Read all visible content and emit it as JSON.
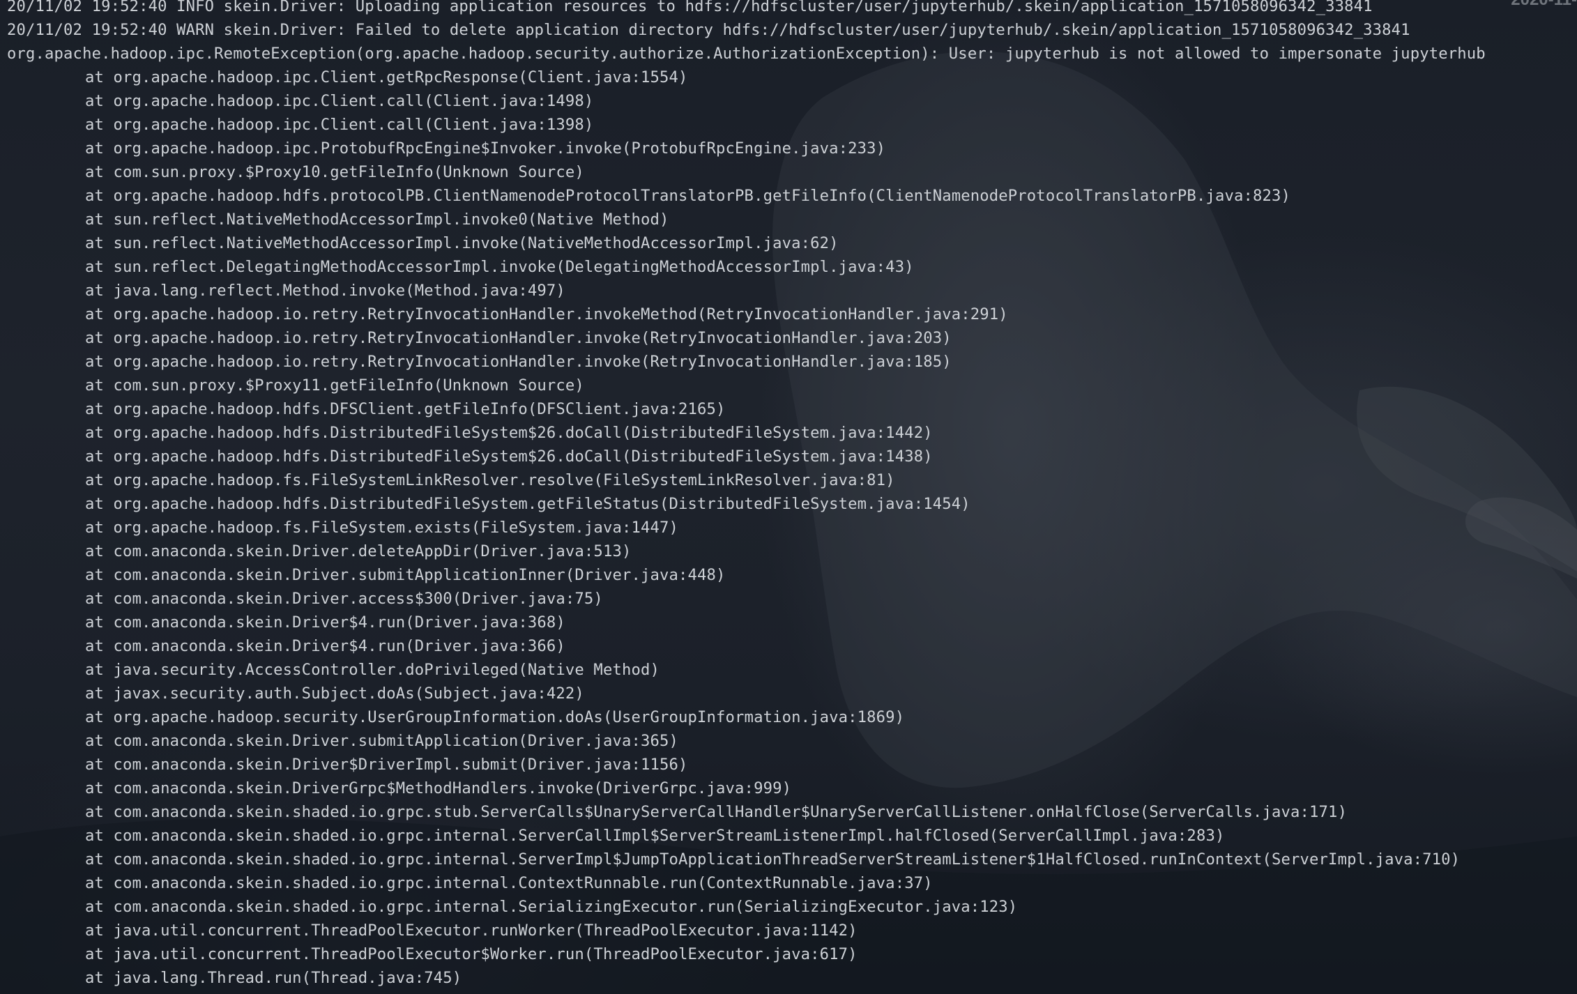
{
  "window": {
    "clock_fragment": "2020-11-"
  },
  "log": {
    "header_lines": [
      "20/11/02 19:52:40 INFO skein.Driver: Uploading application resources to hdfs://hdfscluster/user/jupyterhub/.skein/application_1571058096342_33841",
      "20/11/02 19:52:40 WARN skein.Driver: Failed to delete application directory hdfs://hdfscluster/user/jupyterhub/.skein/application_1571058096342_33841",
      "org.apache.hadoop.ipc.RemoteException(org.apache.hadoop.security.authorize.AuthorizationException): User: jupyterhub is not allowed to impersonate jupyterhub"
    ],
    "stack_frames": [
      "at org.apache.hadoop.ipc.Client.getRpcResponse(Client.java:1554)",
      "at org.apache.hadoop.ipc.Client.call(Client.java:1498)",
      "at org.apache.hadoop.ipc.Client.call(Client.java:1398)",
      "at org.apache.hadoop.ipc.ProtobufRpcEngine$Invoker.invoke(ProtobufRpcEngine.java:233)",
      "at com.sun.proxy.$Proxy10.getFileInfo(Unknown Source)",
      "at org.apache.hadoop.hdfs.protocolPB.ClientNamenodeProtocolTranslatorPB.getFileInfo(ClientNamenodeProtocolTranslatorPB.java:823)",
      "at sun.reflect.NativeMethodAccessorImpl.invoke0(Native Method)",
      "at sun.reflect.NativeMethodAccessorImpl.invoke(NativeMethodAccessorImpl.java:62)",
      "at sun.reflect.DelegatingMethodAccessorImpl.invoke(DelegatingMethodAccessorImpl.java:43)",
      "at java.lang.reflect.Method.invoke(Method.java:497)",
      "at org.apache.hadoop.io.retry.RetryInvocationHandler.invokeMethod(RetryInvocationHandler.java:291)",
      "at org.apache.hadoop.io.retry.RetryInvocationHandler.invoke(RetryInvocationHandler.java:203)",
      "at org.apache.hadoop.io.retry.RetryInvocationHandler.invoke(RetryInvocationHandler.java:185)",
      "at com.sun.proxy.$Proxy11.getFileInfo(Unknown Source)",
      "at org.apache.hadoop.hdfs.DFSClient.getFileInfo(DFSClient.java:2165)",
      "at org.apache.hadoop.hdfs.DistributedFileSystem$26.doCall(DistributedFileSystem.java:1442)",
      "at org.apache.hadoop.hdfs.DistributedFileSystem$26.doCall(DistributedFileSystem.java:1438)",
      "at org.apache.hadoop.fs.FileSystemLinkResolver.resolve(FileSystemLinkResolver.java:81)",
      "at org.apache.hadoop.hdfs.DistributedFileSystem.getFileStatus(DistributedFileSystem.java:1454)",
      "at org.apache.hadoop.fs.FileSystem.exists(FileSystem.java:1447)",
      "at com.anaconda.skein.Driver.deleteAppDir(Driver.java:513)",
      "at com.anaconda.skein.Driver.submitApplicationInner(Driver.java:448)",
      "at com.anaconda.skein.Driver.access$300(Driver.java:75)",
      "at com.anaconda.skein.Driver$4.run(Driver.java:368)",
      "at com.anaconda.skein.Driver$4.run(Driver.java:366)",
      "at java.security.AccessController.doPrivileged(Native Method)",
      "at javax.security.auth.Subject.doAs(Subject.java:422)",
      "at org.apache.hadoop.security.UserGroupInformation.doAs(UserGroupInformation.java:1869)",
      "at com.anaconda.skein.Driver.submitApplication(Driver.java:365)",
      "at com.anaconda.skein.Driver$DriverImpl.submit(Driver.java:1156)",
      "at com.anaconda.skein.DriverGrpc$MethodHandlers.invoke(DriverGrpc.java:999)",
      "at com.anaconda.skein.shaded.io.grpc.stub.ServerCalls$UnaryServerCallHandler$UnaryServerCallListener.onHalfClose(ServerCalls.java:171)",
      "at com.anaconda.skein.shaded.io.grpc.internal.ServerCallImpl$ServerStreamListenerImpl.halfClosed(ServerCallImpl.java:283)",
      "at com.anaconda.skein.shaded.io.grpc.internal.ServerImpl$JumpToApplicationThreadServerStreamListener$1HalfClosed.runInContext(ServerImpl.java:710)",
      "at com.anaconda.skein.shaded.io.grpc.internal.ContextRunnable.run(ContextRunnable.java:37)",
      "at com.anaconda.skein.shaded.io.grpc.internal.SerializingExecutor.run(SerializingExecutor.java:123)",
      "at java.util.concurrent.ThreadPoolExecutor.runWorker(ThreadPoolExecutor.java:1142)",
      "at java.util.concurrent.ThreadPoolExecutor$Worker.run(ThreadPoolExecutor.java:617)",
      "at java.lang.Thread.run(Thread.java:745)"
    ]
  }
}
